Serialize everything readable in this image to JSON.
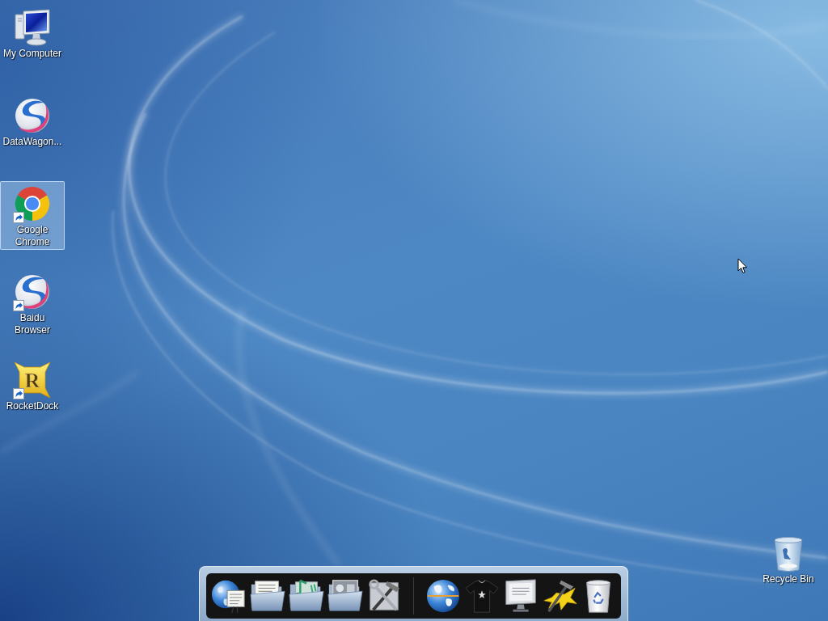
{
  "desktop_icons": [
    {
      "label": "My Computer",
      "kind": "computer",
      "selected": false,
      "shortcut": false
    },
    {
      "label": "DataWagon...",
      "kind": "swirl",
      "selected": false,
      "shortcut": false
    },
    {
      "label": "Google Chrome",
      "kind": "chrome",
      "selected": true,
      "shortcut": true
    },
    {
      "label": "Baidu Browser",
      "kind": "swirl",
      "selected": false,
      "shortcut": true
    },
    {
      "label": "RocketDock",
      "kind": "rocketdock",
      "glyph": "R",
      "selected": false,
      "shortcut": true
    }
  ],
  "recycle_bin": {
    "label": "Recycle Bin",
    "kind": "recycle-bin",
    "selected": false
  },
  "dock": {
    "groups": [
      {
        "items": [
          {
            "kind": "globe-document"
          },
          {
            "kind": "folder"
          },
          {
            "kind": "music-folder"
          },
          {
            "kind": "picture-folder"
          },
          {
            "kind": "tools"
          }
        ]
      },
      {
        "items": [
          {
            "kind": "globe"
          },
          {
            "kind": "shirt"
          },
          {
            "kind": "monitor"
          },
          {
            "kind": "yellow-tools"
          },
          {
            "kind": "trash"
          }
        ]
      }
    ]
  }
}
